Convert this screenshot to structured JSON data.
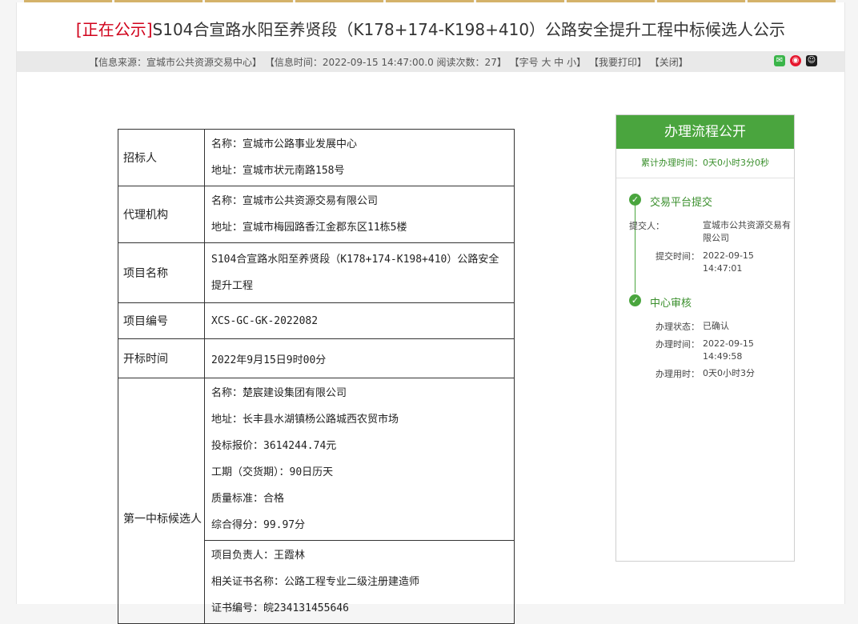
{
  "notice": {
    "tag": "[正在公示]",
    "title": "S104合宣路水阳至养贤段（K178+174-K198+410）公路安全提升工程中标候选人公示"
  },
  "meta": {
    "source": "【信息来源：宣城市公共资源交易中心】",
    "time": "【信息时间：2022-09-15 14:47:00.0 阅读次数：27】",
    "font_size": "【字号 大 中 小】",
    "print": "【我要打印】",
    "close": "【关闭】"
  },
  "share": {
    "icons": [
      "wechat-icon",
      "weibo-icon",
      "qq-icon"
    ]
  },
  "table": {
    "tenderer_label": "招标人",
    "tenderer_name": "名称：宣城市公路事业发展中心",
    "tenderer_addr": "地址：宣城市状元南路158号",
    "agent_label": "代理机构",
    "agent_name": "名称：宣城市公共资源交易有限公司",
    "agent_addr": "地址：宣城市梅园路香江金郡东区11栋5楼",
    "project_label": "项目名称",
    "project_name": "S104合宣路水阳至养贤段（K178+174-K198+410）公路安全提升工程",
    "code_label": "项目编号",
    "code": "XCS-GC-GK-2022082",
    "open_label": "开标时间",
    "open_time": "2022年9月15日9时00分",
    "first_label": "第一中标候选人",
    "first_name": "名称：楚宸建设集团有限公司",
    "first_addr": "地址：长丰县水湖镇杨公路城西农贸市场",
    "first_price": "投标报价：3614244.74元",
    "first_period": "工期（交货期）：90日历天",
    "first_quality": "质量标准：合格",
    "first_score": "综合得分：99.97分",
    "pm": "项目负责人：王霞林",
    "cert_name": "相关证书名称：公路工程专业二级注册建造师",
    "cert_no": "证书编号：皖234131455646"
  },
  "process": {
    "title": "办理流程公开",
    "total": "累计办理时间：0天0小时3分0秒",
    "step1": {
      "name": "交易平台提交",
      "submitter_label": "提交人：",
      "submitter": "宣城市公共资源交易有限公司",
      "time_label": "提交时间：",
      "time": "2022-09-15 14:47:01"
    },
    "step2": {
      "name": "中心审核",
      "status_label": "办理状态：",
      "status": "已确认",
      "time_label": "办理时间：",
      "time": "2022-09-15 14:49:58",
      "used_label": "办理用时：",
      "used": "0天0小时3分"
    }
  },
  "colors": {
    "accent": "#4aa53e",
    "tag": "#d0021b"
  }
}
